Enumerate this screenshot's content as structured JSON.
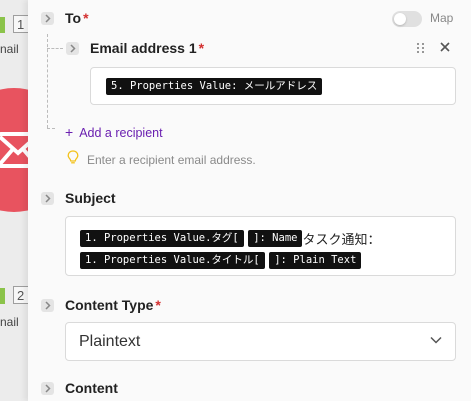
{
  "canvas": {
    "node_badge_1": "1",
    "node_label_1": "nail",
    "node_badge_2": "2",
    "node_label_2": "nail"
  },
  "to": {
    "label": "To",
    "required_mark": "*",
    "map_label": "Map",
    "map_enabled": false
  },
  "recipient": {
    "label": "Email address 1",
    "required_mark": "*",
    "value_tokens": [
      "5. Properties Value: メールアドレス"
    ]
  },
  "add_recipient": {
    "plus": "+",
    "label": "Add a recipient"
  },
  "hint": {
    "text": "Enter a recipient email address."
  },
  "subject": {
    "label": "Subject",
    "line1": {
      "token1": "1. Properties Value.タグ[",
      "token2": "]: Name",
      "text": "タスク通知："
    },
    "line2": {
      "token1": "1. Properties Value.タイトル[",
      "token2": "]: Plain Text"
    }
  },
  "content_type": {
    "label": "Content Type",
    "required_mark": "*",
    "selected": "Plaintext"
  },
  "content": {
    "label": "Content"
  },
  "colors": {
    "accent_purple": "#6a1fb0",
    "required_red": "#d32f2f",
    "node_red": "#e8535f",
    "token_bg": "#111111"
  }
}
